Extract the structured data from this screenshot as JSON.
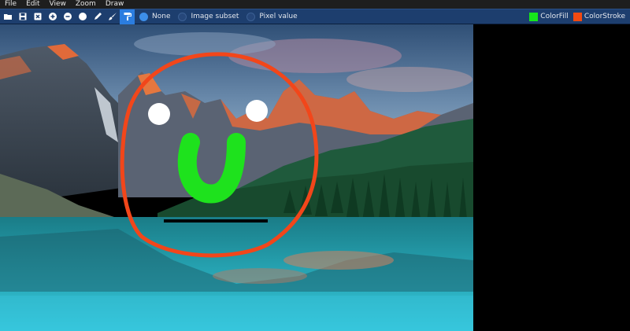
{
  "menu": [
    "File",
    "Edit",
    "View",
    "Zoom",
    "Draw"
  ],
  "toolbar": {
    "buttons": [
      {
        "icon": "folder-open-icon"
      },
      {
        "icon": "save-icon"
      },
      {
        "icon": "close-icon"
      },
      {
        "icon": "zoom-in-icon"
      },
      {
        "icon": "zoom-out-icon"
      },
      {
        "icon": "circle-icon"
      },
      {
        "icon": "pencil-icon"
      },
      {
        "icon": "brush-icon"
      },
      {
        "icon": "paint-roller-icon",
        "active": true
      }
    ],
    "radios": [
      {
        "label": "None",
        "selected": true
      },
      {
        "label": "Image subset",
        "selected": false
      },
      {
        "label": "Pixel value",
        "selected": false
      }
    ],
    "colors": [
      {
        "label": "ColorFill",
        "color": "#16e51c"
      },
      {
        "label": "ColorStroke",
        "color": "#f24a12"
      }
    ]
  },
  "canvas": {
    "background": "#000000",
    "image": "mountain-lake-landscape",
    "drawing": {
      "stroke_color": "#f2461a",
      "fill_color": "#1ee21d",
      "eyes_color": "#ffffff",
      "mouth_color": "#000000"
    }
  }
}
